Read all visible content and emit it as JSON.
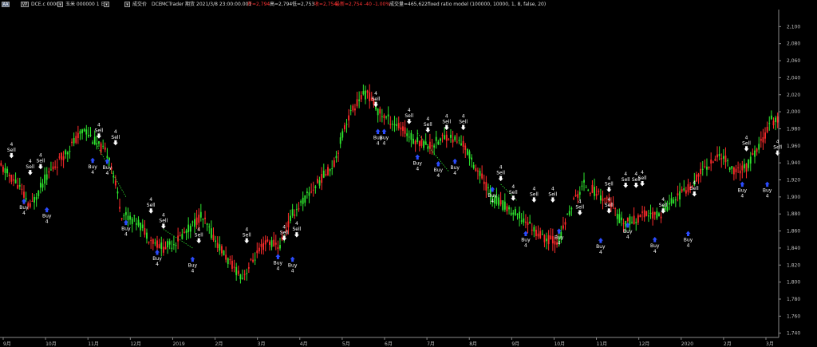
{
  "header": {
    "chart_type_btn": "AA",
    "mode_btn": "VP",
    "symbol_dropdown": "DCE.c 0000",
    "name": "玉米 000000 1 日",
    "data_type": "成交价",
    "exchange": "DCE",
    "platform": "MCTrader",
    "session": "期货",
    "timestamp": "2021/3/8 23:00:00.001",
    "open": "开=2,794",
    "high": "高=2,794",
    "low": "低=2,753",
    "close": "收=2,754",
    "change": "最新=2,754 -40 -1.00%",
    "volume": "成交量=465,622",
    "strategy": "fixed ratio model (100000, 10000, 1, 8, false, 20)",
    "colors": {
      "open": "#ff3333",
      "close": "#ff3333",
      "change": "#ff3333",
      "text": "#dddddd"
    }
  },
  "chart_data": {
    "type": "candlestick",
    "title": "",
    "xlabel": "",
    "ylabel": "",
    "ylim": [
      1735,
      2120
    ],
    "y_ticks": [
      1740,
      1760,
      1780,
      1800,
      1820,
      1840,
      1860,
      1880,
      1900,
      1920,
      1940,
      1960,
      1980,
      2000,
      2020,
      2040,
      2060,
      2080,
      2100
    ],
    "x_ticks": [
      "9月",
      "10月",
      "11月",
      "12月",
      "2019",
      "2月",
      "3月",
      "4月",
      "5月",
      "6月",
      "7月",
      "8月",
      "9月",
      "10月",
      "11月",
      "12月",
      "2020",
      "2月",
      "3月"
    ],
    "colors": {
      "up": "#ff2b2b",
      "down": "#2ee62e",
      "buy": "#2b4cff",
      "sell": "#ffffff",
      "stop_line": "#2ee62e"
    },
    "trend_anchors": [
      {
        "bar": 0,
        "price": 1935
      },
      {
        "bar": 8,
        "price": 1915
      },
      {
        "bar": 14,
        "price": 1888
      },
      {
        "bar": 22,
        "price": 1925
      },
      {
        "bar": 32,
        "price": 1955
      },
      {
        "bar": 40,
        "price": 1980
      },
      {
        "bar": 46,
        "price": 1962
      },
      {
        "bar": 52,
        "price": 1948
      },
      {
        "bar": 58,
        "price": 1880
      },
      {
        "bar": 66,
        "price": 1870
      },
      {
        "bar": 72,
        "price": 1850
      },
      {
        "bar": 78,
        "price": 1840
      },
      {
        "bar": 84,
        "price": 1848
      },
      {
        "bar": 90,
        "price": 1862
      },
      {
        "bar": 96,
        "price": 1878
      },
      {
        "bar": 104,
        "price": 1845
      },
      {
        "bar": 110,
        "price": 1822
      },
      {
        "bar": 116,
        "price": 1806
      },
      {
        "bar": 122,
        "price": 1830
      },
      {
        "bar": 128,
        "price": 1848
      },
      {
        "bar": 134,
        "price": 1842
      },
      {
        "bar": 140,
        "price": 1880
      },
      {
        "bar": 150,
        "price": 1910
      },
      {
        "bar": 160,
        "price": 1940
      },
      {
        "bar": 166,
        "price": 1990
      },
      {
        "bar": 172,
        "price": 2015
      },
      {
        "bar": 176,
        "price": 2022
      },
      {
        "bar": 182,
        "price": 1998
      },
      {
        "bar": 190,
        "price": 1985
      },
      {
        "bar": 198,
        "price": 1968
      },
      {
        "bar": 206,
        "price": 1960
      },
      {
        "bar": 214,
        "price": 1972
      },
      {
        "bar": 222,
        "price": 1962
      },
      {
        "bar": 228,
        "price": 1935
      },
      {
        "bar": 236,
        "price": 1900
      },
      {
        "bar": 244,
        "price": 1885
      },
      {
        "bar": 252,
        "price": 1872
      },
      {
        "bar": 260,
        "price": 1852
      },
      {
        "bar": 268,
        "price": 1848
      },
      {
        "bar": 274,
        "price": 1890
      },
      {
        "bar": 280,
        "price": 1915
      },
      {
        "bar": 286,
        "price": 1905
      },
      {
        "bar": 292,
        "price": 1895
      },
      {
        "bar": 298,
        "price": 1870
      },
      {
        "bar": 304,
        "price": 1872
      },
      {
        "bar": 310,
        "price": 1880
      },
      {
        "bar": 316,
        "price": 1878
      },
      {
        "bar": 322,
        "price": 1895
      },
      {
        "bar": 330,
        "price": 1910
      },
      {
        "bar": 338,
        "price": 1935
      },
      {
        "bar": 346,
        "price": 1950
      },
      {
        "bar": 352,
        "price": 1930
      },
      {
        "bar": 358,
        "price": 1935
      },
      {
        "bar": 364,
        "price": 1958
      },
      {
        "bar": 370,
        "price": 1990
      }
    ],
    "signals": [
      {
        "bar": 5,
        "type": "sell",
        "label": "Sell",
        "qty": "4",
        "price": 1945
      },
      {
        "bar": 11,
        "type": "buy",
        "label": "Buy",
        "qty": "4",
        "price": 1898
      },
      {
        "bar": 14,
        "type": "sell",
        "label": "Sell",
        "qty": "4",
        "price": 1925
      },
      {
        "bar": 19,
        "type": "sell",
        "label": "Sell",
        "qty": "4",
        "price": 1932
      },
      {
        "bar": 22,
        "type": "buy",
        "label": "Buy",
        "qty": "4",
        "price": 1888
      },
      {
        "bar": 44,
        "type": "buy",
        "label": "Buy",
        "qty": "4",
        "price": 1946
      },
      {
        "bar": 47,
        "type": "sell",
        "label": "Sell",
        "qty": "4",
        "price": 1968
      },
      {
        "bar": 51,
        "type": "buy",
        "label": "Buy",
        "qty": "4",
        "price": 1945
      },
      {
        "bar": 55,
        "type": "sell",
        "label": "Sell",
        "qty": "4",
        "price": 1960
      },
      {
        "bar": 60,
        "type": "buy",
        "label": "Buy",
        "qty": "4",
        "price": 1873
      },
      {
        "bar": 72,
        "type": "sell",
        "label": "Sell",
        "qty": "4",
        "price": 1880
      },
      {
        "bar": 75,
        "type": "buy",
        "label": "Buy",
        "qty": "4",
        "price": 1838
      },
      {
        "bar": 78,
        "type": "sell",
        "label": "Sell",
        "qty": "4",
        "price": 1862
      },
      {
        "bar": 92,
        "type": "buy",
        "label": "Buy",
        "qty": "4",
        "price": 1830
      },
      {
        "bar": 95,
        "type": "sell",
        "label": "Sell",
        "qty": "4",
        "price": 1845
      },
      {
        "bar": 118,
        "type": "sell",
        "label": "Sell",
        "qty": "4",
        "price": 1845
      },
      {
        "bar": 133,
        "type": "buy",
        "label": "Buy",
        "qty": "4",
        "price": 1833
      },
      {
        "bar": 136,
        "type": "sell",
        "label": "Sell",
        "qty": "4",
        "price": 1848
      },
      {
        "bar": 140,
        "type": "buy",
        "label": "Buy",
        "qty": "4",
        "price": 1830
      },
      {
        "bar": 142,
        "type": "sell",
        "label": "Sell",
        "qty": "4",
        "price": 1852
      },
      {
        "bar": 180,
        "type": "sell",
        "label": "Sell",
        "qty": "4",
        "price": 2005
      },
      {
        "bar": 181,
        "type": "buy",
        "label": "Buy",
        "qty": "4",
        "price": 1980
      },
      {
        "bar": 184,
        "type": "buy",
        "label": "Buy",
        "qty": "4",
        "price": 1980
      },
      {
        "bar": 196,
        "type": "sell",
        "label": "Sell",
        "qty": "4",
        "price": 1985
      },
      {
        "bar": 200,
        "type": "buy",
        "label": "Buy",
        "qty": "4",
        "price": 1950
      },
      {
        "bar": 205,
        "type": "sell",
        "label": "Sell",
        "qty": "4",
        "price": 1975
      },
      {
        "bar": 210,
        "type": "buy",
        "label": "Buy",
        "qty": "4",
        "price": 1942
      },
      {
        "bar": 214,
        "type": "sell",
        "label": "Sell",
        "qty": "4",
        "price": 1978
      },
      {
        "bar": 218,
        "type": "buy",
        "label": "Buy",
        "qty": "4",
        "price": 1945
      },
      {
        "bar": 222,
        "type": "sell",
        "label": "Sell",
        "qty": "4",
        "price": 1978
      },
      {
        "bar": 236,
        "type": "buy",
        "label": "Buy",
        "qty": "4",
        "price": 1912
      },
      {
        "bar": 240,
        "type": "sell",
        "label": "Sell",
        "qty": "4",
        "price": 1918
      },
      {
        "bar": 246,
        "type": "sell",
        "label": "Sell",
        "qty": "4",
        "price": 1895
      },
      {
        "bar": 252,
        "type": "buy",
        "label": "Buy",
        "qty": "4",
        "price": 1860
      },
      {
        "bar": 256,
        "type": "sell",
        "label": "Sell",
        "qty": "4",
        "price": 1893
      },
      {
        "bar": 265,
        "type": "sell",
        "label": "Sell",
        "qty": "4",
        "price": 1893
      },
      {
        "bar": 268,
        "type": "buy",
        "label": "Buy",
        "qty": "4",
        "price": 1863
      },
      {
        "bar": 278,
        "type": "sell",
        "label": "Sell",
        "qty": "4",
        "price": 1878
      },
      {
        "bar": 288,
        "type": "buy",
        "label": "Buy",
        "qty": "4",
        "price": 1852
      },
      {
        "bar": 292,
        "type": "sell",
        "label": "Sell",
        "qty": "4",
        "price": 1880
      },
      {
        "bar": 292,
        "type": "sell",
        "label": "Sell",
        "qty": "4",
        "price": 1905
      },
      {
        "bar": 300,
        "type": "sell",
        "label": "Sell",
        "qty": "4",
        "price": 1910
      },
      {
        "bar": 301,
        "type": "buy",
        "label": "Buy",
        "qty": "4",
        "price": 1870
      },
      {
        "bar": 305,
        "type": "sell",
        "label": "Sell",
        "qty": "4",
        "price": 1910
      },
      {
        "bar": 308,
        "type": "sell",
        "label": "Sell",
        "qty": "4",
        "price": 1912
      },
      {
        "bar": 314,
        "type": "buy",
        "label": "Buy",
        "qty": "4",
        "price": 1853
      },
      {
        "bar": 318,
        "type": "sell",
        "label": "Sell",
        "qty": "4",
        "price": 1880
      },
      {
        "bar": 330,
        "type": "buy",
        "label": "Buy",
        "qty": "4",
        "price": 1860
      },
      {
        "bar": 333,
        "type": "sell",
        "label": "Sell",
        "qty": "4",
        "price": 1900
      },
      {
        "bar": 356,
        "type": "buy",
        "label": "Buy",
        "qty": "4",
        "price": 1918
      },
      {
        "bar": 358,
        "type": "sell",
        "label": "Sell",
        "qty": "4",
        "price": 1953
      },
      {
        "bar": 368,
        "type": "buy",
        "label": "Buy",
        "qty": "4",
        "price": 1918
      },
      {
        "bar": 373,
        "type": "sell",
        "label": "Sell",
        "qty": "4",
        "price": 1948
      }
    ]
  }
}
